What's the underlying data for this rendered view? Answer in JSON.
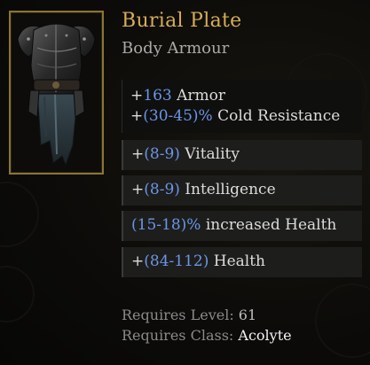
{
  "item": {
    "name": "Burial Plate",
    "type": "Body Armour",
    "implicits": [
      {
        "prefix": "+",
        "value": "163",
        "suffix": " Armor"
      },
      {
        "prefix": "+",
        "value": "(30-45)%",
        "suffix": " Cold Resistance"
      }
    ],
    "affixes": [
      {
        "prefix": "+",
        "value": "(8-9)",
        "suffix": " Vitality"
      },
      {
        "prefix": "+",
        "value": "(8-9)",
        "suffix": " Intelligence"
      },
      {
        "prefix": "",
        "value": "(15-18)%",
        "suffix": " increased Health"
      },
      {
        "prefix": "+",
        "value": "(84-112)",
        "suffix": " Health"
      }
    ],
    "requirements": {
      "level_label": "Requires Level:",
      "level_value": "61",
      "class_label": "Requires Class:",
      "class_value": "Acolyte"
    }
  },
  "colors": {
    "title": "#d6ad55",
    "value_blue": "#6b96e6",
    "frame_gold": "#8a7531"
  },
  "icons": {
    "item_image": "dark-plate-armour-icon"
  }
}
